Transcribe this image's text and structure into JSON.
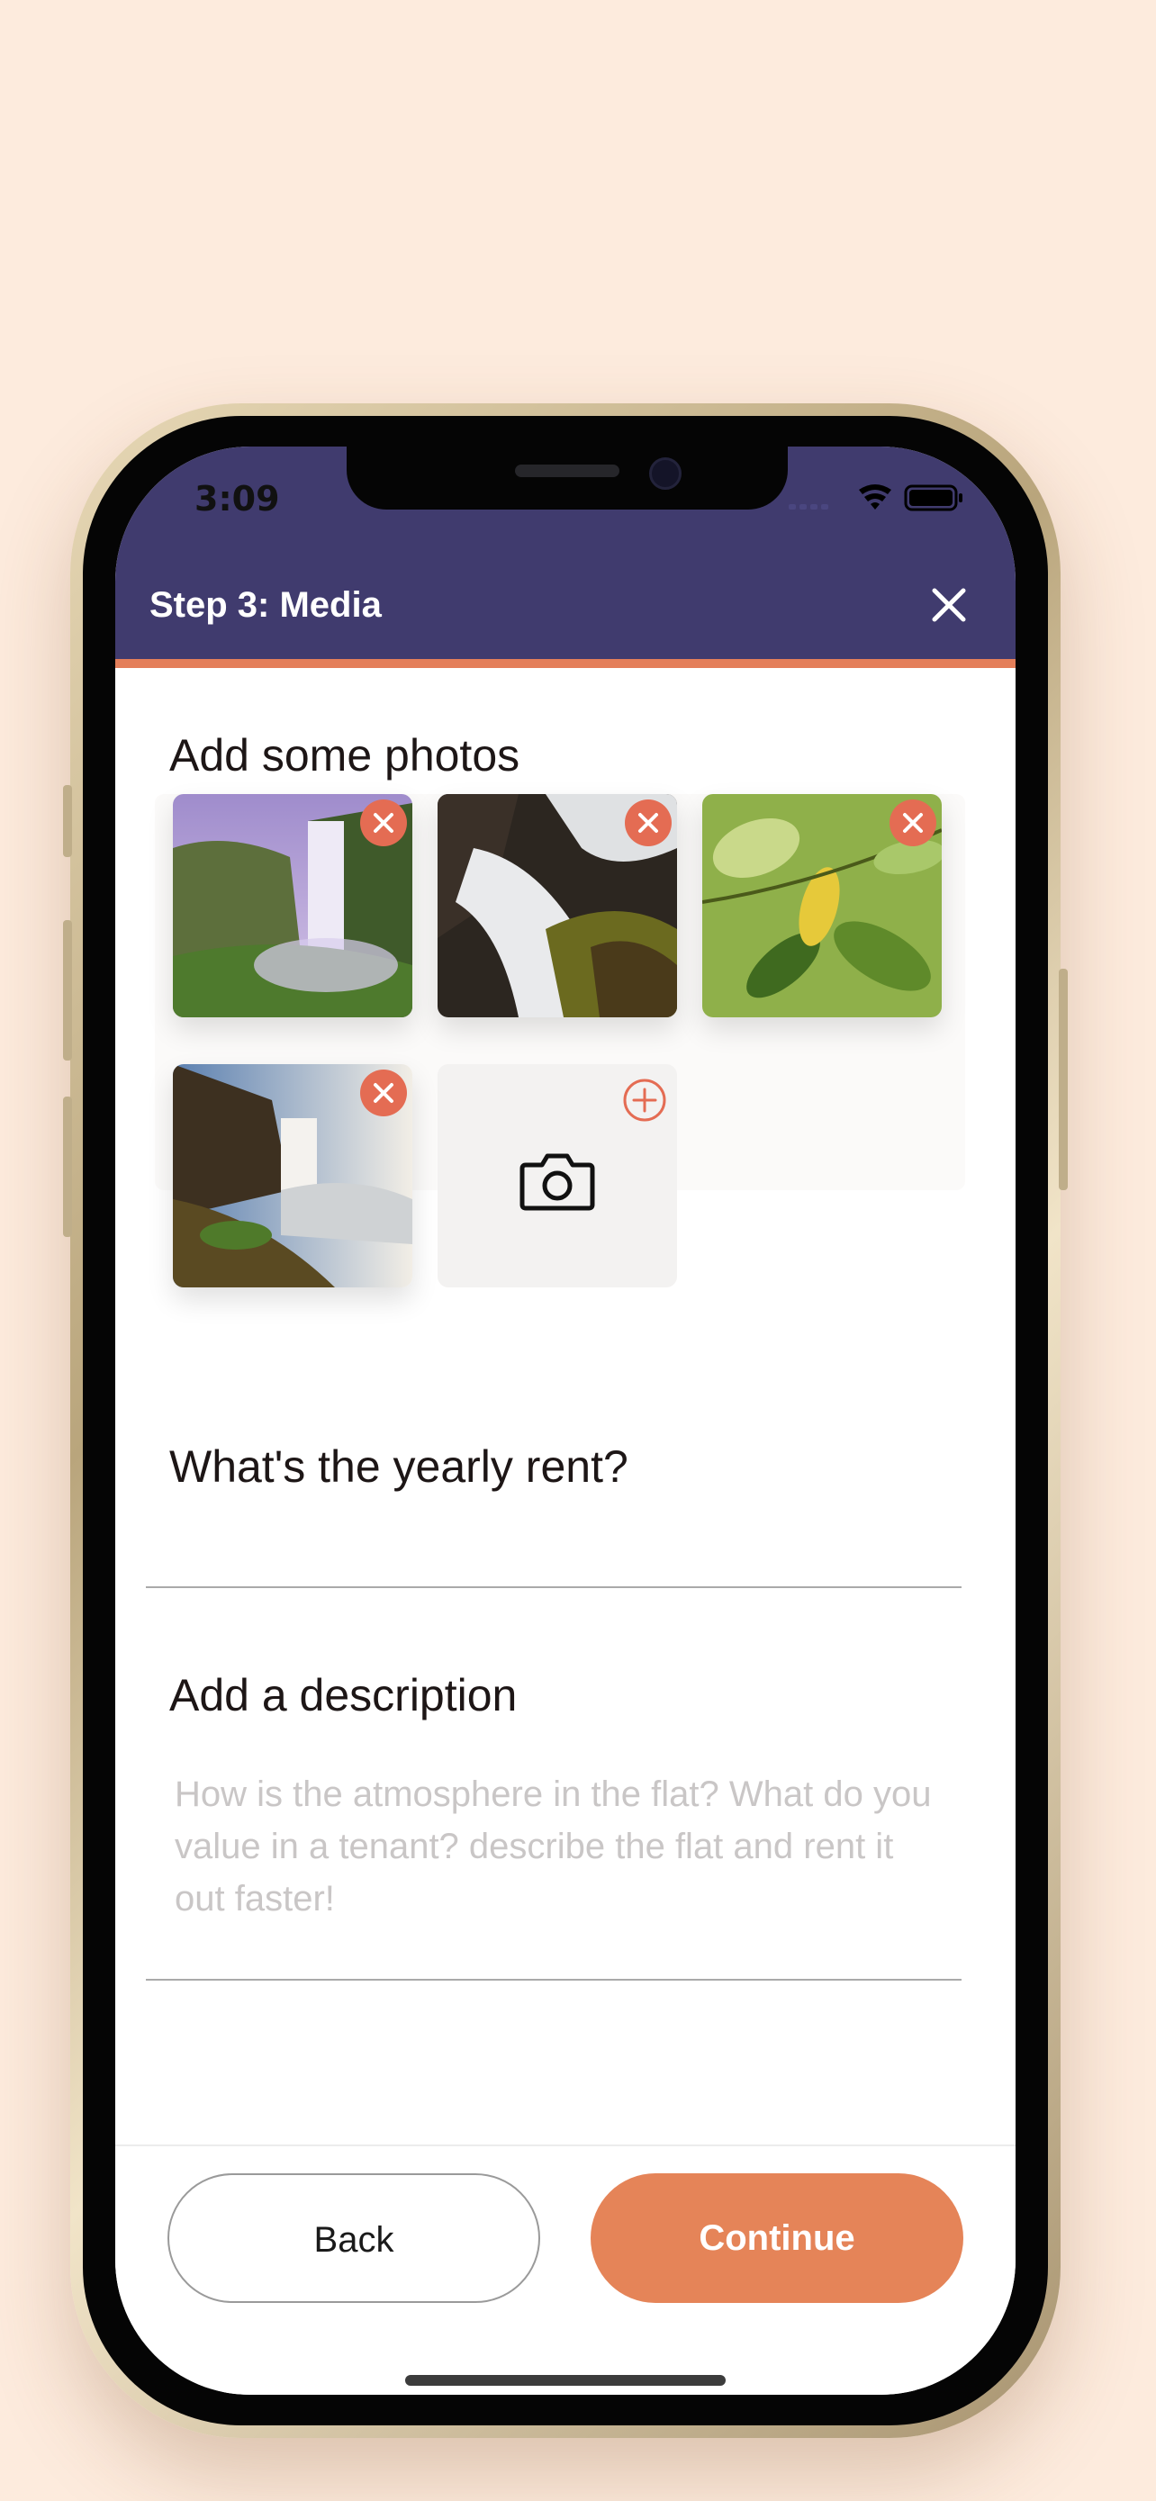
{
  "status_bar": {
    "time": "3:09"
  },
  "header": {
    "title": "Step 3: Media",
    "close_icon": "close-icon"
  },
  "photos_section": {
    "title": "Add some photos",
    "photos": [
      {
        "label": "photo-waterfall-mist",
        "remove_icon": "remove-icon"
      },
      {
        "label": "photo-waterfall-rocks",
        "remove_icon": "remove-icon"
      },
      {
        "label": "photo-green-leaves",
        "remove_icon": "remove-icon"
      },
      {
        "label": "photo-waterfall-cliff",
        "remove_icon": "remove-icon"
      }
    ],
    "add_tile": {
      "camera_icon": "camera-icon",
      "plus_icon": "plus-circle-icon"
    }
  },
  "rent_section": {
    "title": "What's the yearly rent?",
    "value": ""
  },
  "description_section": {
    "title": "Add a description",
    "placeholder": "How is the atmosphere in the flat? What do you value in a tenant? describe the flat and rent it out faster!"
  },
  "footer": {
    "back_label": "Back",
    "continue_label": "Continue"
  },
  "colors": {
    "header_bg": "#403b6e",
    "accent": "#e58458",
    "remove_badge": "#e46c53",
    "page_bg": "#fdebdd"
  }
}
